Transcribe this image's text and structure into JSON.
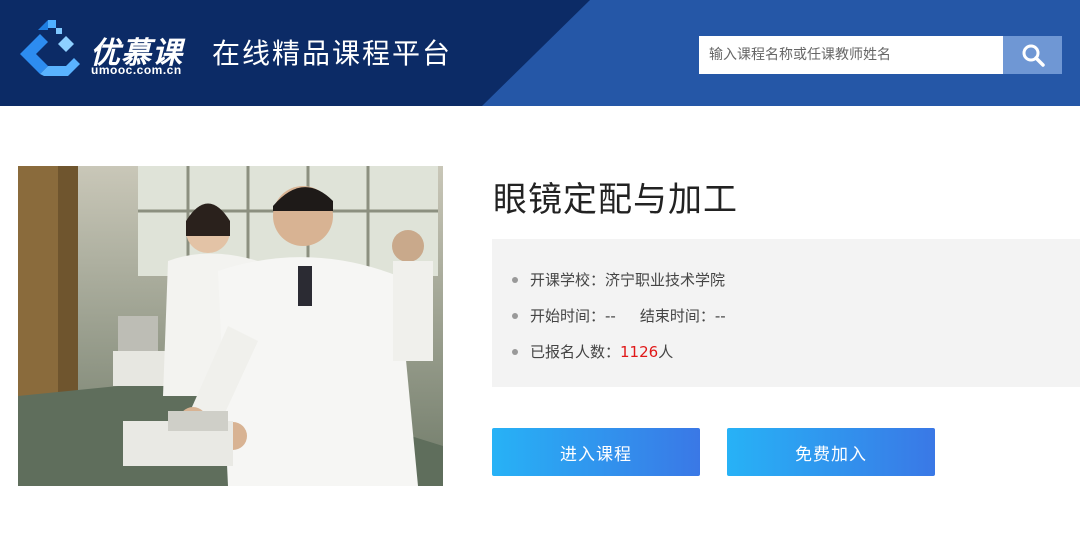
{
  "header": {
    "logo_text": "优慕课",
    "logo_domain": "umooc.com.cn",
    "platform_title": "在线精品课程平台",
    "search_placeholder": "输入课程名称或任课教师姓名",
    "search_icon": "search-icon"
  },
  "course": {
    "title": "眼镜定配与加工",
    "school_label": "开课学校：",
    "school": "济宁职业技术学院",
    "start_label": "开始时间：",
    "start_value": "--",
    "end_label": "结束时间：",
    "end_value": "--",
    "enrolled_label": "已报名人数：",
    "enrolled_count": "1126",
    "enrolled_unit": "人"
  },
  "actions": {
    "enter_course": "进入课程",
    "free_join": "免费加入"
  },
  "colors": {
    "header_dark": "#0c2b66",
    "header_blue": "#2557a7",
    "button_start": "#27b2f6",
    "button_end": "#3a78e6",
    "count_red": "#e01818"
  }
}
